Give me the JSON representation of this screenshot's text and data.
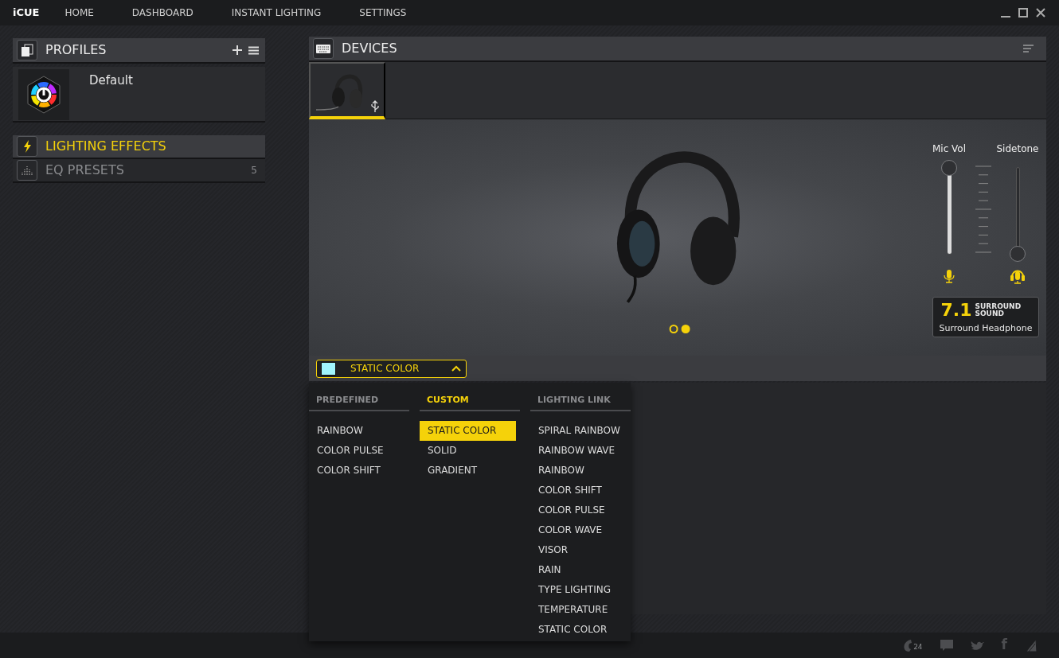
{
  "app": {
    "logo": "iCUE"
  },
  "nav": [
    {
      "label": "HOME"
    },
    {
      "label": "DASHBOARD"
    },
    {
      "label": "INSTANT LIGHTING"
    },
    {
      "label": "SETTINGS"
    }
  ],
  "profiles": {
    "title": "PROFILES",
    "items": [
      {
        "name": "Default"
      }
    ]
  },
  "sections": [
    {
      "kind": "lighting",
      "label": "LIGHTING EFFECTS",
      "selected": true
    },
    {
      "kind": "eq",
      "label": "EQ PRESETS",
      "count": "5",
      "selected": false
    }
  ],
  "devices": {
    "title": "DEVICES",
    "items": [
      {
        "selected": true
      }
    ]
  },
  "preview": {
    "pages": [
      {
        "selected": false
      },
      {
        "selected": true
      }
    ]
  },
  "sliders": [
    {
      "label": "Mic Vol",
      "level": 1
    },
    {
      "label": "Sidetone",
      "level": 0
    }
  ],
  "surround": {
    "number": "7.1",
    "label": "SURROUND SOUND",
    "mode": "Surround Headphone"
  },
  "effect": {
    "name": "STATIC COLOR",
    "color": "#a0f4fc",
    "expanded": true
  },
  "menu": {
    "columns": [
      {
        "title": "PREDEFINED",
        "selected": false,
        "items": [
          {
            "label": "RAINBOW",
            "selected": false
          },
          {
            "label": "COLOR PULSE",
            "selected": false
          },
          {
            "label": "COLOR SHIFT",
            "selected": false
          }
        ]
      },
      {
        "title": "CUSTOM",
        "selected": true,
        "items": [
          {
            "label": "STATIC COLOR",
            "selected": true
          },
          {
            "label": "SOLID",
            "selected": false
          },
          {
            "label": "GRADIENT",
            "selected": false
          }
        ]
      },
      {
        "title": "LIGHTING LINK",
        "selected": false,
        "items": [
          {
            "label": "SPIRAL RAINBOW",
            "selected": false
          },
          {
            "label": "RAINBOW WAVE",
            "selected": false
          },
          {
            "label": "RAINBOW",
            "selected": false
          },
          {
            "label": "COLOR SHIFT",
            "selected": false
          },
          {
            "label": "COLOR PULSE",
            "selected": false
          },
          {
            "label": "COLOR WAVE",
            "selected": false
          },
          {
            "label": "VISOR",
            "selected": false
          },
          {
            "label": "RAIN",
            "selected": false
          },
          {
            "label": "TYPE LIGHTING",
            "selected": false
          },
          {
            "label": "TEMPERATURE",
            "selected": false
          },
          {
            "label": "STATIC COLOR",
            "selected": false
          }
        ]
      }
    ]
  },
  "footer": {
    "support_badge": "24",
    "social_letter": "f"
  }
}
